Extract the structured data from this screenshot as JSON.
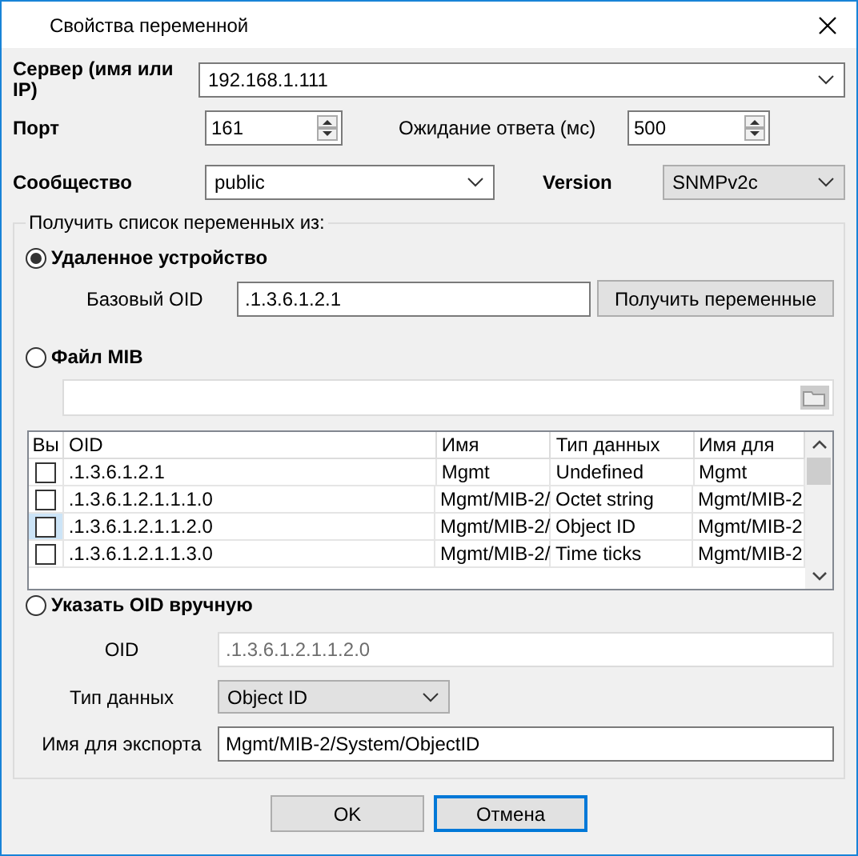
{
  "window": {
    "title": "Свойства переменной"
  },
  "server": {
    "label": "Сервер (имя или IP)",
    "value": "192.168.1.111"
  },
  "port": {
    "label": "Порт",
    "value": "161"
  },
  "timeout": {
    "label": "Ожидание ответа (мс)",
    "value": "500"
  },
  "community": {
    "label": "Сообщество",
    "value": "public"
  },
  "version": {
    "label": "Version",
    "value": "SNMPv2c",
    "disabled": true
  },
  "source": {
    "legend": "Получить список переменных из:",
    "remote": {
      "label": "Удаленное устройство",
      "selected": true,
      "base_oid_label": "Базовый OID",
      "base_oid_value": ".1.3.6.1.2.1",
      "button": "Получить переменные"
    },
    "mib_file": {
      "label": "Файл MIB",
      "selected": false
    },
    "table": {
      "columns": [
        "Вы",
        "OID",
        "Имя",
        "Тип данных",
        "Имя для"
      ],
      "rows": [
        {
          "checked": false,
          "focused": false,
          "cells": [
            "",
            ".1.3.6.1.2.1",
            "Mgmt",
            "Undefined",
            "Mgmt"
          ]
        },
        {
          "checked": false,
          "focused": false,
          "cells": [
            "",
            ".1.3.6.1.2.1.1.1.0",
            "Mgmt/MIB-2/",
            "Octet string",
            "Mgmt/MIB-2"
          ]
        },
        {
          "checked": false,
          "focused": true,
          "cells": [
            "",
            ".1.3.6.1.2.1.1.2.0",
            "Mgmt/MIB-2/",
            "Object ID",
            "Mgmt/MIB-2"
          ]
        },
        {
          "checked": false,
          "focused": false,
          "cells": [
            "",
            ".1.3.6.1.2.1.1.3.0",
            "Mgmt/MIB-2/",
            "Time ticks",
            "Mgmt/MIB-2"
          ]
        }
      ]
    },
    "manual": {
      "label": "Указать OID вручную",
      "selected": false,
      "oid_label": "OID",
      "oid_value": ".1.3.6.1.2.1.1.2.0",
      "oid_disabled": true,
      "type_label": "Тип данных",
      "type_value": "Object ID",
      "export_label": "Имя для экспорта",
      "export_value": "Mgmt/MIB-2/System/ObjectID"
    }
  },
  "buttons": [
    {
      "label": "OK",
      "default": false
    },
    {
      "label": "Отмена",
      "default": true
    }
  ]
}
